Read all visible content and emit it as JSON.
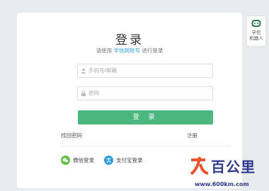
{
  "login": {
    "title": "登录",
    "subtitle_prefix": "请使用",
    "subtitle_link": "学信网账号",
    "subtitle_suffix": "进行登录",
    "username_placeholder": "手机号/邮箱",
    "password_placeholder": "密码",
    "login_button": "登 录",
    "forgot_password": "找回密码",
    "register": "注册",
    "wechat_login": "微信登录",
    "alipay_login": "支付宝登录"
  },
  "side_widget": {
    "line1": "学信",
    "line2": "机器人"
  },
  "watermark": {
    "name": "百公里",
    "url": "www.600km.com"
  },
  "colors": {
    "accent": "#4cb77f",
    "link": "#3aa0d5",
    "wechat": "#5ebf3c",
    "alipay": "#2d9ee0",
    "watermark": "#2f3a8f",
    "watermark_mark": "#e8542b"
  }
}
